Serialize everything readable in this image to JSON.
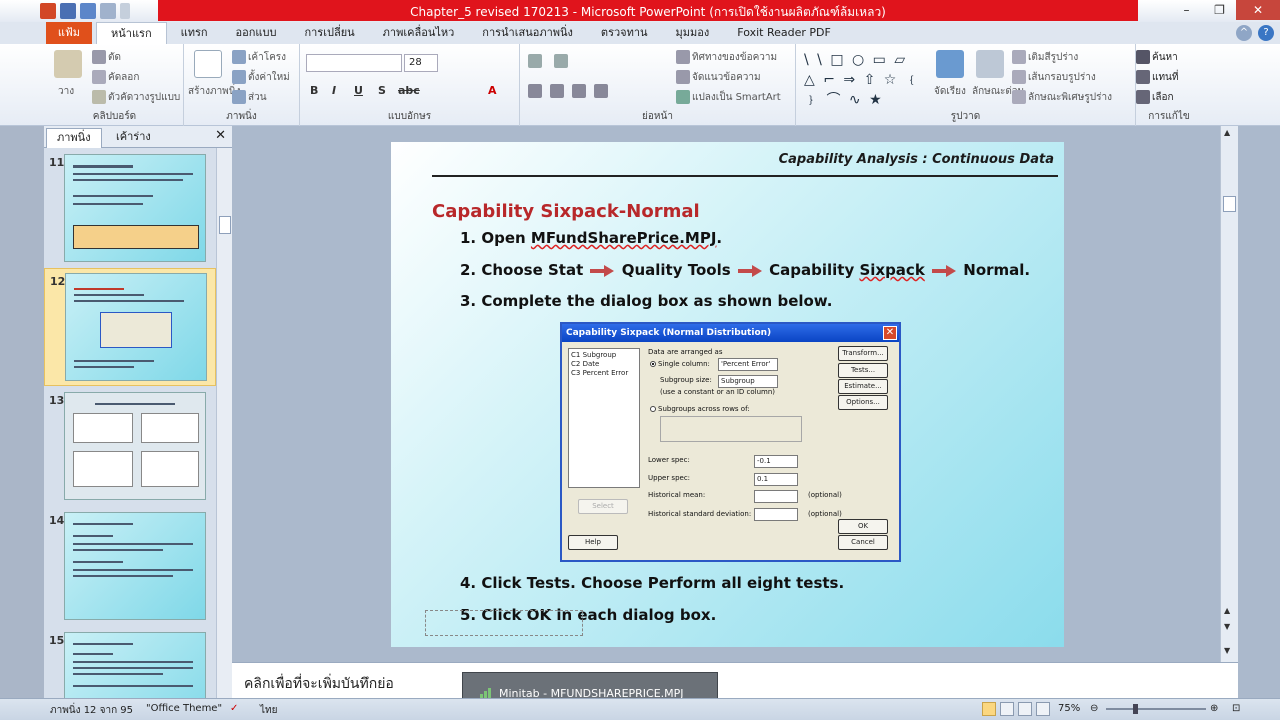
{
  "window": {
    "title": "Chapter_5 revised 170213 - Microsoft PowerPoint (การเปิดใช้งานผลิตภัณฑ์ล้มเหลว)",
    "controls": [
      "–",
      "❐",
      "✕"
    ]
  },
  "ribbon_tabs": {
    "file": "แฟ้ม",
    "items": [
      "หน้าแรก",
      "แทรก",
      "ออกแบบ",
      "การเปลี่ยน",
      "ภาพเคลื่อนไหว",
      "การนำเสนอภาพนิ่ง",
      "ตรวจทาน",
      "มุมมอง",
      "Foxit Reader PDF"
    ],
    "active_index": 0
  },
  "ribbon": {
    "clipboard": {
      "label": "คลิปบอร์ด",
      "paste": "วาง",
      "cut": "ตัด",
      "copy": "คัดลอก",
      "format_painter": "ตัวคัดวางรูปแบบ"
    },
    "slides": {
      "label": "ภาพนิ่ง",
      "new_slide": "สร้างภาพนิ่ง",
      "layout": "เค้าโครง",
      "reset": "ตั้งค่าใหม่",
      "section": "ส่วน"
    },
    "font": {
      "label": "แบบอักษร",
      "font_name": "",
      "font_size": "28"
    },
    "paragraph": {
      "label": "ย่อหน้า",
      "text_direction": "ทิศทางของข้อความ",
      "align_text": "จัดแนวข้อความ",
      "smartart": "แปลงเป็น SmartArt"
    },
    "drawing": {
      "label": "รูปวาด",
      "arrange": "จัดเรียง",
      "quick_styles": "ลักษณะด่วน",
      "fill": "เติมสีรูปร่าง",
      "outline": "เส้นกรอบรูปร่าง",
      "effects": "ลักษณะพิเศษรูปร่าง"
    },
    "editing": {
      "label": "การแก้ไข",
      "find": "ค้นหา",
      "replace": "แทนที่",
      "select": "เลือก"
    }
  },
  "slides_pane": {
    "tab_slides": "ภาพนิ่ง",
    "tab_outline": "เค้าร่าง",
    "slide_numbers": [
      "11",
      "12",
      "13",
      "14",
      "15"
    ],
    "selected": "12"
  },
  "slide": {
    "header": "Capability Analysis : Continuous Data",
    "title": "Capability Sixpack-Normal",
    "step1_num": "1. Open ",
    "step1_file": "MFundSharePrice.MPJ",
    "step1_end": ".",
    "step2_a": "2. Choose Stat",
    "step2_b": "Quality Tools",
    "step2_c": "Capability ",
    "step2_c2": "Sixpack",
    "step2_d": "Normal.",
    "step3": "3. Complete the dialog box as shown below.",
    "step4": "4. Click Tests. Choose Perform all eight tests.",
    "step5": "5. Click OK in each dialog box."
  },
  "dialog": {
    "title": "Capability Sixpack (Normal Distribution)",
    "columns": [
      "C1    Subgroup",
      "C2    Date",
      "C3    Percent Error"
    ],
    "arranged_as": "Data are arranged as",
    "single_column": "Single column:",
    "single_column_value": "'Percent Error'",
    "subgroup_size": "Subgroup size:",
    "subgroup_size_value": "Subgroup",
    "subgroup_hint": "(use a constant or an ID column)",
    "across_rows": "Subgroups across rows of:",
    "lower_spec": "Lower spec:",
    "lower_spec_value": "-0.1",
    "upper_spec": "Upper spec:",
    "upper_spec_value": "0.1",
    "hist_mean": "Historical mean:",
    "hist_sd": "Historical standard deviation:",
    "optional": "(optional)",
    "btn_transform": "Transform...",
    "btn_tests": "Tests...",
    "btn_estimate": "Estimate...",
    "btn_options": "Options...",
    "btn_select": "Select",
    "btn_help": "Help",
    "btn_ok": "OK",
    "btn_cancel": "Cancel"
  },
  "notes": {
    "placeholder": "คลิกเพื่อที่จะเพิ่มบันทึกย่อ"
  },
  "taskbar_popup": {
    "label": "Minitab - MFUNDSHAREPRICE.MPJ"
  },
  "status": {
    "slide_info": "ภาพนิ่ง 12 จาก 95",
    "theme": "\"Office Theme\"",
    "language": "ไทย",
    "zoom": "75%"
  }
}
